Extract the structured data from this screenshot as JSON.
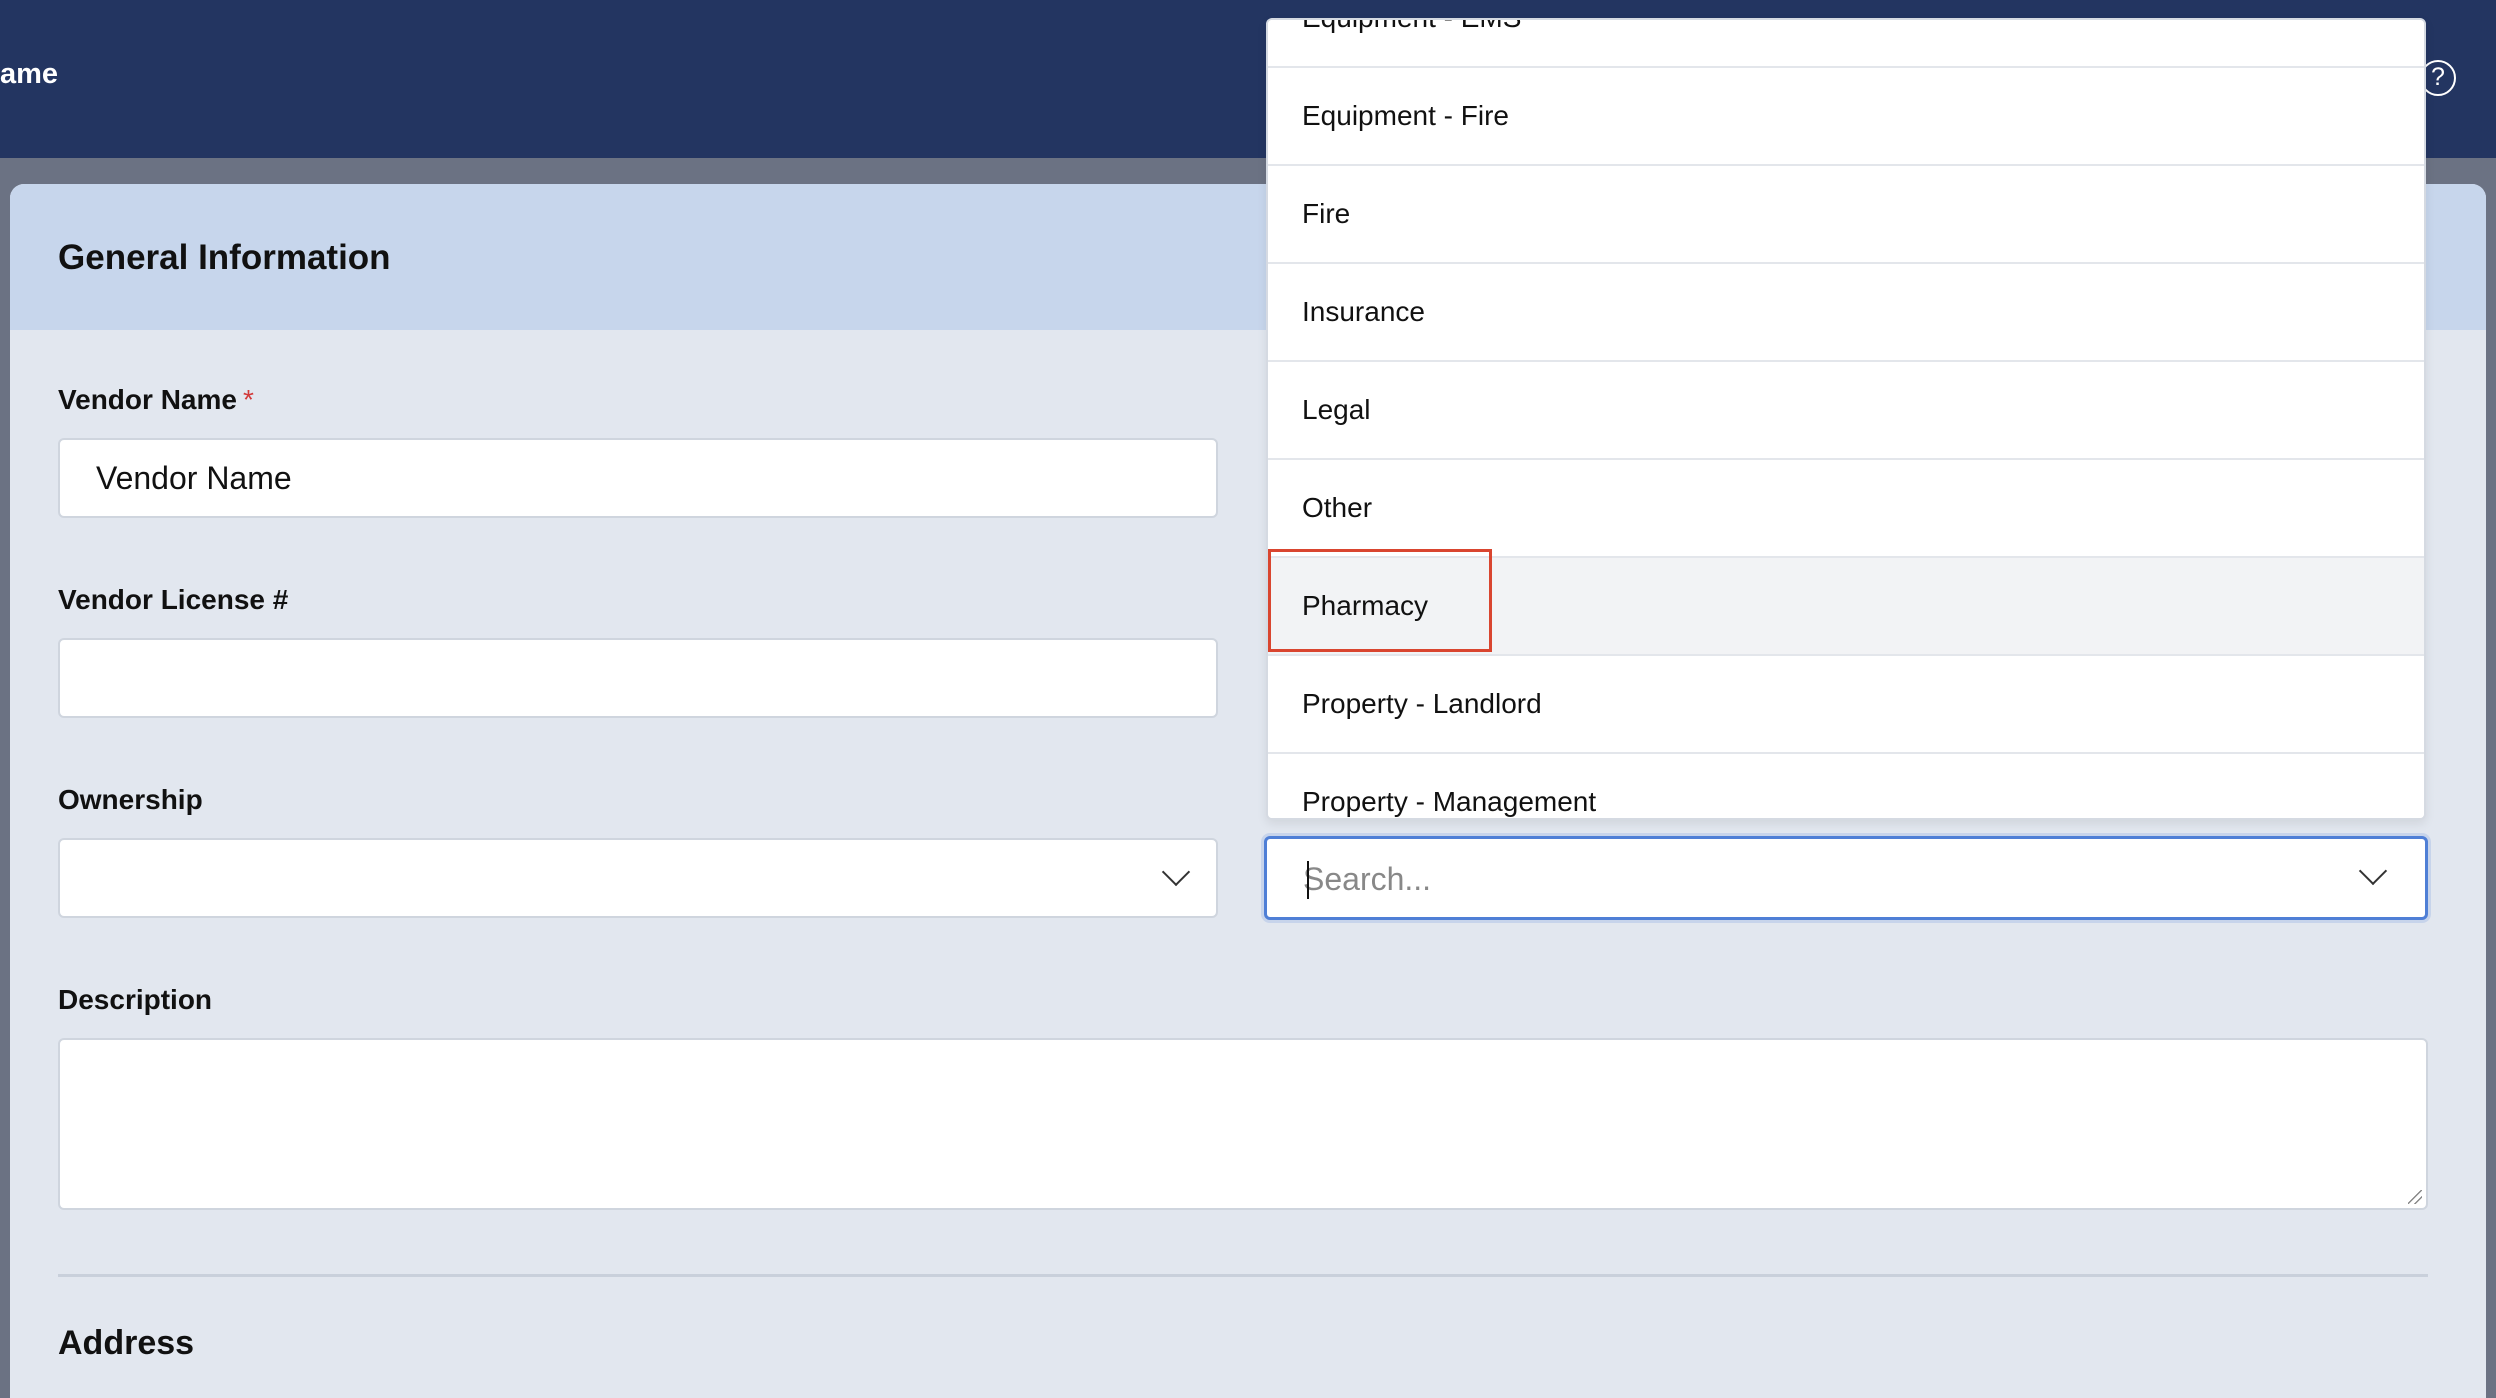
{
  "header": {
    "title": "ame",
    "help_icon": "?"
  },
  "form": {
    "section_title": "General Information",
    "vendor_name": {
      "label": "Vendor Name",
      "required_marker": "*",
      "value": "Vendor Name"
    },
    "vendor_license": {
      "label": "Vendor License #",
      "value": ""
    },
    "ownership": {
      "label": "Ownership",
      "value": ""
    },
    "description": {
      "label": "Description",
      "value": ""
    },
    "address_title": "Address"
  },
  "category_dropdown": {
    "search_placeholder": "Search...",
    "options": [
      "Equipment - EMS",
      "Equipment - Fire",
      "Fire",
      "Insurance",
      "Legal",
      "Other",
      "Pharmacy",
      "Property - Landlord",
      "Property - Management"
    ],
    "hovered_option": "Pharmacy"
  },
  "colors": {
    "topbar": "#233561",
    "panel_header": "#c7d6ec",
    "panel_bg": "#e2e7ef",
    "focus_border": "#4f7fd6",
    "highlight_box": "#d9452f",
    "required": "#d23a3a"
  }
}
